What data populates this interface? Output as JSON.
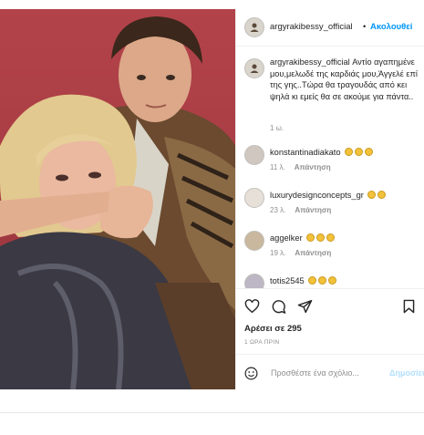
{
  "post": {
    "username": "argyrakibessy_official",
    "follow_label": "Ακολουθεί",
    "dot": "•",
    "caption_user": "argyrakibessy_official",
    "caption_text": " Αντίο αγαπημένε μου,μελωδέ της καρδιάς μου,Άγγελέ επί της γης..Τώρα θα τραγουδάς από κει ψηλά κι εμείς θα σε ακούμε για πάντα..",
    "caption_time": "1 ω.",
    "likes": "Αρέσει σε 295",
    "posted_ago": "1 ΩΡΑ ΠΡΙΝ"
  },
  "comments": [
    {
      "user": "konstantinadiakato",
      "emojis": 3,
      "time": "11 λ.",
      "reply": "Απάντηση"
    },
    {
      "user": "luxurydesignconcepts_gr",
      "emojis": 2,
      "time": "23 λ.",
      "reply": "Απάντηση"
    },
    {
      "user": "aggelker",
      "emojis": 3,
      "time": "19 λ.",
      "reply": "Απάντηση"
    },
    {
      "user": "totis2545",
      "emojis": 3,
      "time": "",
      "reply": ""
    }
  ],
  "add_comment": {
    "placeholder": "Προσθέστε ένα σχόλιο...",
    "post_label": "Δημοσίευση"
  },
  "icons": {
    "like": "heart-icon",
    "comment": "comment-icon",
    "share": "share-icon",
    "save": "bookmark-icon",
    "emoji": "smiley-icon"
  },
  "colors": {
    "follow": "#0095f6",
    "muted": "#8e8e8e",
    "post_disabled": "#b2dffc",
    "photo_background": "#a83c44"
  }
}
